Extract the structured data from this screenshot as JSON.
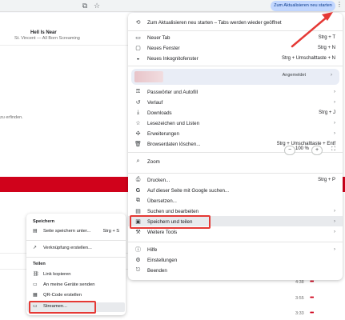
{
  "toolbar": {
    "translate_icon": "translate-icon",
    "star_icon": "star-icon",
    "update_button": "Zum Aktualisieren neu starten",
    "menu_icon": "kebab-menu-icon"
  },
  "background": {
    "song_title": "Hell Is Near",
    "song_sub": "St. Vincent — All Born Screaming",
    "left_fragment": "zu erfinden.",
    "times": [
      "4:38",
      "3:55",
      "3:33"
    ]
  },
  "menu": {
    "relaunch": "Zum Aktualisieren neu starten – Tabs werden wieder geöffnet",
    "new_tab": "Neuer Tab",
    "new_tab_short": "Strg + T",
    "new_window": "Neues Fenster",
    "new_window_short": "Strg + N",
    "incognito": "Neues Inkognitofenster",
    "incognito_short": "Strg + Umschalttaste + N",
    "signed_in": "Angemeldet",
    "passwords": "Passwörter und Autofill",
    "history": "Verlauf",
    "downloads": "Downloads",
    "downloads_short": "Strg + J",
    "bookmarks": "Lesezeichen und Listen",
    "extensions": "Erweiterungen",
    "clear_data": "Browserdaten löschen...",
    "clear_data_short": "Strg + Umschalttaste + Entf",
    "zoom": "Zoom",
    "zoom_minus": "−",
    "zoom_value": "100 %",
    "zoom_plus": "+",
    "print": "Drucken...",
    "print_short": "Strg + P",
    "google_search": "Auf dieser Seite mit Google suchen...",
    "translate": "Übersetzen...",
    "search_edit": "Suchen und bearbeiten",
    "save_share": "Speichern und teilen",
    "more_tools": "Weitere Tools",
    "help": "Hilfe",
    "settings": "Einstellungen",
    "exit": "Beenden"
  },
  "submenu": {
    "save_header": "Speichern",
    "save_page": "Seite speichern unter...",
    "save_page_short": "Strg + S",
    "create_shortcut": "Verknüpfung erstellen...",
    "share_header": "Teilen",
    "copy_link": "Link kopieren",
    "send_devices": "An meine Geräte senden",
    "qr_code": "QR-Code erstellen",
    "stream": "Streamen..."
  },
  "colors": {
    "accent_red": "#e53935",
    "page_red": "#d0021b",
    "update_pill": "#c2d7ff"
  }
}
